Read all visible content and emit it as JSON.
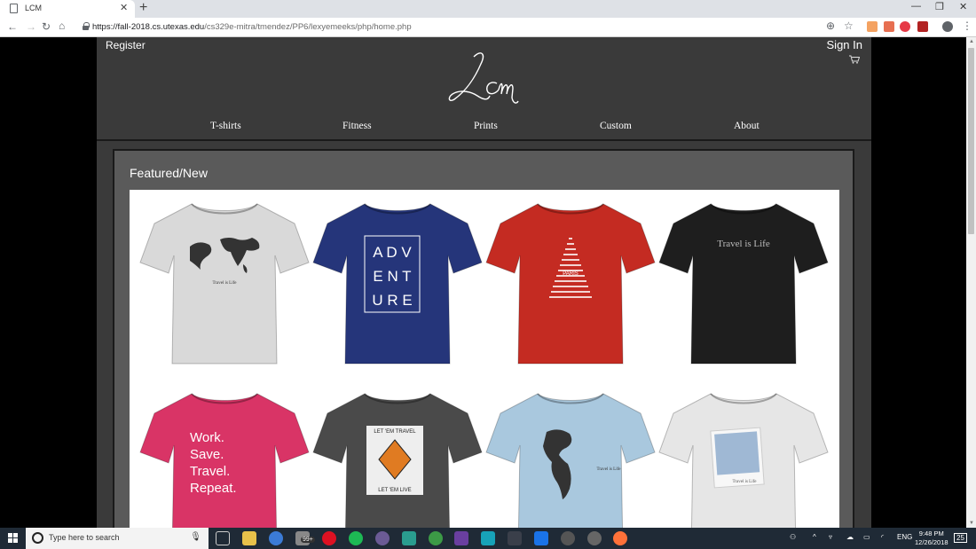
{
  "browser": {
    "tab_title": "LCM",
    "tab_close": "✕",
    "new_tab": "+",
    "url_host": "https://fall-2018.cs.utexas.edu",
    "url_path": "/cs329e-mitra/tmendez/PP6/lexyemeeks/php/home.php",
    "window_controls": [
      "—",
      "❐",
      "✕"
    ]
  },
  "site": {
    "register_label": "Register",
    "signin_label": "Sign In",
    "logo_text": "Lcm",
    "nav": [
      {
        "label": "T-shirts"
      },
      {
        "label": "Fitness"
      },
      {
        "label": "Prints"
      },
      {
        "label": "Custom"
      },
      {
        "label": "About"
      }
    ],
    "featured_title": "Featured/New",
    "products": [
      {
        "color": "#d9d9d9",
        "design": "world-map",
        "text": "Travel is Life"
      },
      {
        "color": "#25357a",
        "design": "adventure",
        "text": "ADV ENT URE"
      },
      {
        "color": "#c42b22",
        "design": "eiffel-words",
        "text": "PARIS"
      },
      {
        "color": "#1e1e1e",
        "design": "script",
        "text": "Travel is Life"
      },
      {
        "color": "#d93466",
        "design": "work-save",
        "text": "Work. Save. Travel. Repeat."
      },
      {
        "color": "#4a4a4a",
        "design": "hiker-sign",
        "text": "LET 'EM TRAVEL / LET 'EM LIVE"
      },
      {
        "color": "#a9c8de",
        "design": "americas",
        "text": "Travel is Life"
      },
      {
        "color": "#e6e6e6",
        "design": "polaroid",
        "text": "Travel is Life"
      }
    ]
  },
  "taskbar": {
    "search_placeholder": "Type here to search",
    "badge": "99+",
    "language": "ENG",
    "time": "9:48 PM",
    "date": "12/26/2018",
    "notification_count": "25"
  },
  "colors": {
    "site_bg": "#3a3a3a",
    "featured_bg": "#5a5a5a",
    "taskbar_bg": "#1f2a36"
  }
}
